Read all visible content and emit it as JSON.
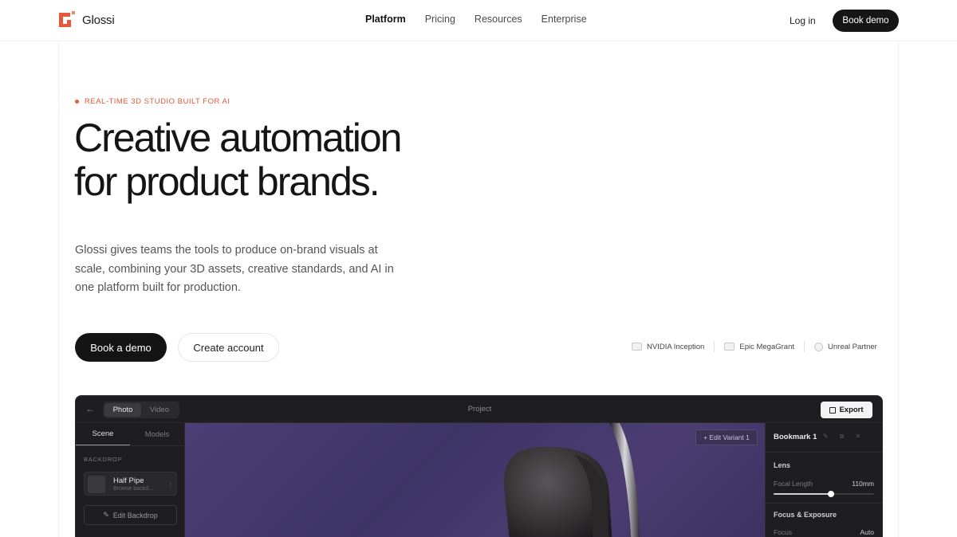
{
  "brand": {
    "name": "Glossi",
    "accent": "#e6583b"
  },
  "nav": {
    "links": [
      "Platform",
      "Pricing",
      "Resources",
      "Enterprise"
    ],
    "active": "Platform",
    "login": "Log in",
    "book_demo": "Book demo"
  },
  "hero": {
    "eyebrow": "REAL-TIME 3D STUDIO BUILT FOR AI",
    "headline_line1": "Creative automation",
    "headline_line2": "for product brands.",
    "subtitle": "Glossi gives teams the tools to produce on-brand visuals at scale, combining your 3D assets, creative standards, and AI in one platform built for production.",
    "primary_cta": "Book a demo",
    "secondary_cta": "Create account"
  },
  "partners": [
    {
      "label": "NVIDIA Inception",
      "icon": "nvidia-icon"
    },
    {
      "label": "Epic MegaGrant",
      "icon": "epic-icon"
    },
    {
      "label": "Unreal Partner",
      "icon": "unreal-icon"
    }
  ],
  "app": {
    "mode_tabs": [
      "Photo",
      "Video"
    ],
    "active_mode": "Photo",
    "project_title": "Project",
    "export_label": "Export",
    "left_tabs": [
      "Scene",
      "Models"
    ],
    "active_left_tab": "Scene",
    "backdrop_section": "BACKDROP",
    "backdrop_name": "Half Pipe",
    "backdrop_sub": "Browse backd...",
    "edit_backdrop": "Edit Backdrop",
    "edit_variant": "+ Edit Variant 1",
    "bookmark_title": "Bookmark 1",
    "lens_heading": "Lens",
    "focal_length_label": "Focal Length",
    "focal_length_value": "110mm",
    "focal_slider_level": 0.57,
    "focus_exposure_heading": "Focus & Exposure",
    "focus_label": "Focus",
    "focus_value": "Auto",
    "viewport_color": "#463c72"
  }
}
